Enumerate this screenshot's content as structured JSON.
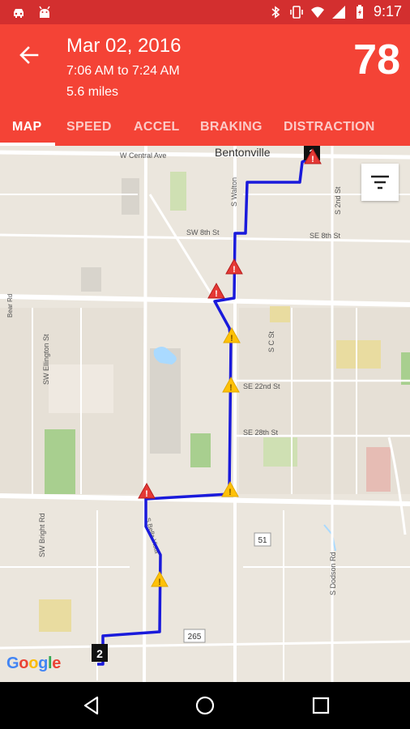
{
  "status_bar": {
    "time": "9:17",
    "icons": [
      "car-icon",
      "android-icon",
      "bluetooth-icon",
      "vibrate-icon",
      "wifi-icon",
      "signal-icon",
      "battery-icon"
    ]
  },
  "header": {
    "date": "Mar 02, 2016",
    "time_range": "7:06 AM to 7:24 AM",
    "distance": "5.6 miles",
    "score": "78",
    "color": "#f44336"
  },
  "tabs": [
    {
      "label": "MAP",
      "active": true
    },
    {
      "label": "SPEED"
    },
    {
      "label": "ACCEL"
    },
    {
      "label": "BRAKING"
    },
    {
      "label": "DISTRACTION"
    }
  ],
  "map": {
    "city_label": "Bentonville",
    "streets": {
      "central_ave": "W Central Ave",
      "sw_8th": "SW 8th St",
      "se_8th": "SE 8th St",
      "se_22nd": "SE 22nd St",
      "se_28th": "SE 28th St",
      "s_2nd": "S 2nd St",
      "s_walton": "S Walton",
      "s_c": "S C St",
      "sw_ellington": "SW Ellington St",
      "sw_bright": "SW Bright Rd",
      "s_dodson": "S Dodson Rd",
      "s_bella": "S Bella Vista",
      "bear_rd": "Bear Rd"
    },
    "shields": {
      "hwy51": "51",
      "hwy265": "265"
    },
    "start_marker": "1",
    "end_marker": "2",
    "route_color": "#1a1adb",
    "attribution": "Google"
  }
}
